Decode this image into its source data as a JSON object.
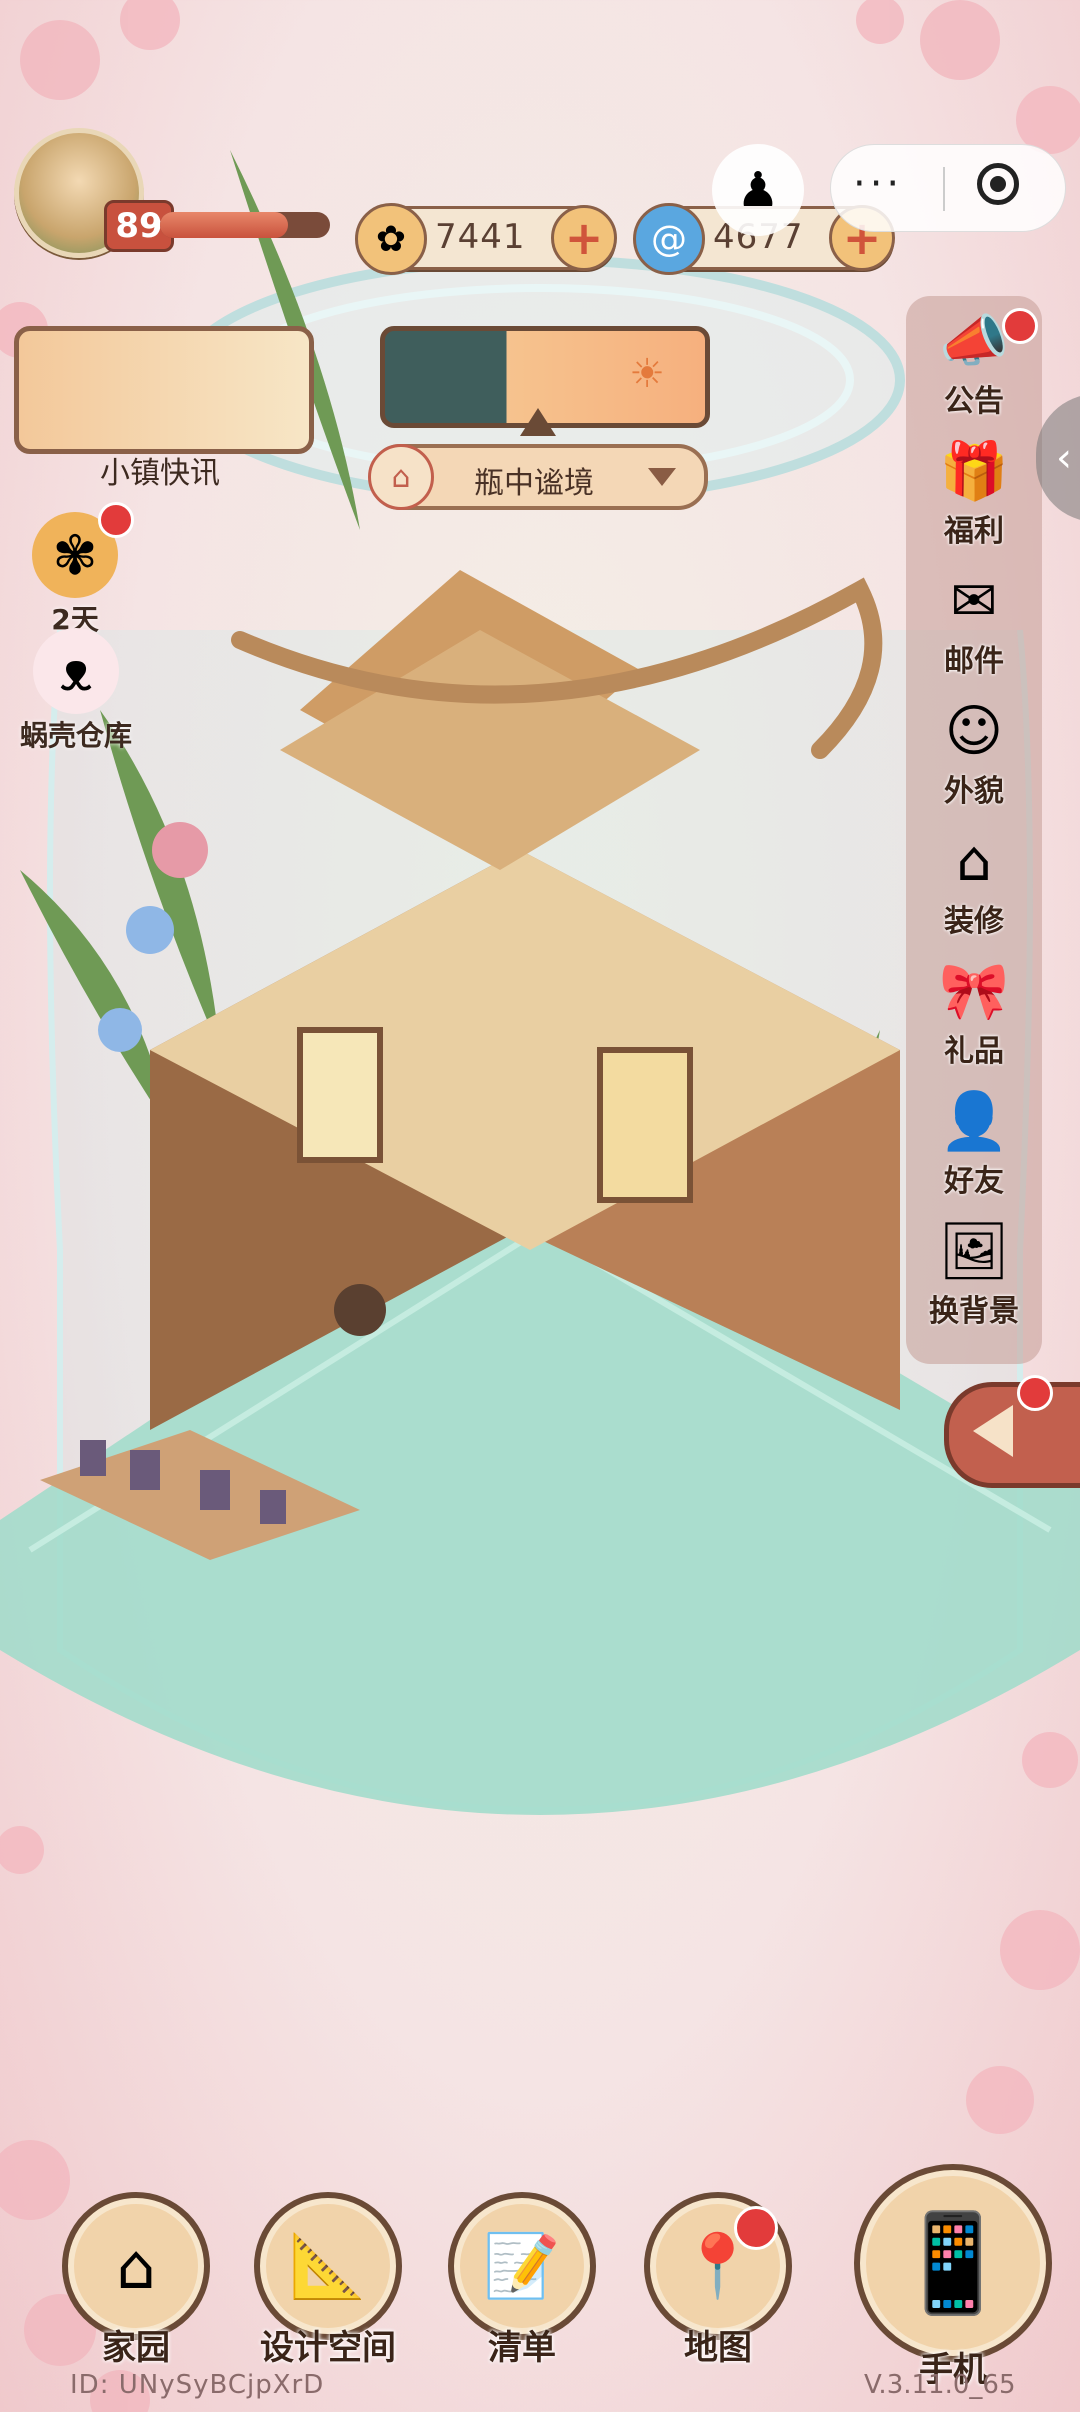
{
  "player": {
    "level": "89",
    "xp_fraction": 0.75
  },
  "currencies": [
    {
      "icon": "gold-coin-icon",
      "amount": "7441",
      "color": "#f2c27a"
    },
    {
      "icon": "blue-swirl-shell-icon",
      "amount": "4677",
      "color": "#5aa7e0"
    }
  ],
  "system": {
    "more": "···"
  },
  "news": {
    "label": "小镇快讯"
  },
  "location": {
    "name": "瓶中谧境"
  },
  "left_items": [
    {
      "label": "2天",
      "icon": "flower-icon"
    },
    {
      "label": "蜗壳仓库",
      "icon": "snail-warehouse-icon"
    }
  ],
  "sidebar": [
    {
      "label": "公告",
      "icon": "megaphone-icon",
      "badge": true
    },
    {
      "label": "福利",
      "icon": "gift-box-icon",
      "badge": false
    },
    {
      "label": "邮件",
      "icon": "mail-icon",
      "badge": false
    },
    {
      "label": "外貌",
      "icon": "character-face-icon",
      "badge": false
    },
    {
      "label": "装修",
      "icon": "house-wrench-icon",
      "badge": false
    },
    {
      "label": "礼品",
      "icon": "present-icon",
      "badge": false
    },
    {
      "label": "好友",
      "icon": "friend-card-icon",
      "badge": false
    },
    {
      "label": "换背景",
      "icon": "background-swap-icon",
      "badge": false
    }
  ],
  "bottom_nav": [
    {
      "label": "家园",
      "icon": "home-icon"
    },
    {
      "label": "设计空间",
      "icon": "design-tools-icon"
    },
    {
      "label": "清单",
      "icon": "checklist-icon"
    },
    {
      "label": "地图",
      "icon": "map-pin-icon",
      "badge": true
    },
    {
      "label": "手机",
      "icon": "phone-icon"
    }
  ],
  "footer": {
    "id": "ID:  UNySyBCjpXrD",
    "version": "V.3.11.0_65"
  },
  "colors": {
    "accent_red": "#e23b3b",
    "frame_brown": "#6a4a36",
    "water_teal": "#9fd9c8"
  }
}
